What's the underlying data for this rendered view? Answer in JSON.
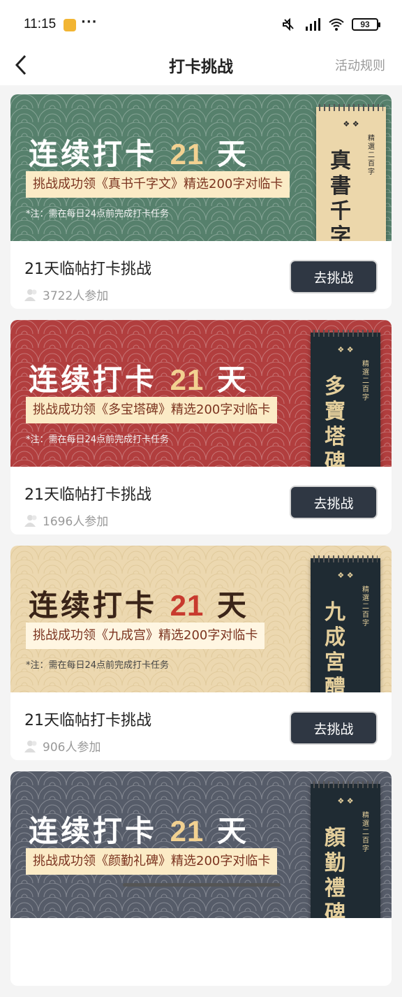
{
  "status": {
    "time": "11:15",
    "battery": "93"
  },
  "header": {
    "title": "打卡挑战",
    "rules_label": "活动规则"
  },
  "challenges": [
    {
      "banner_title": "连续打卡",
      "banner_days": "21",
      "banner_unit": "天",
      "tagline": "挑战成功领《真书千字文》精选200字对临卡",
      "note": "*注：需在每日24点前完成打卡任务",
      "book_title": "真書千字文",
      "book_side": "精選二百字",
      "title": "21天临帖打卡挑战",
      "participants": "3722人参加",
      "button_label": "去挑战",
      "colors": {
        "bg": "#56806c",
        "days": "#f2d191",
        "book_bg": "#ecd7ab",
        "book_text": "#2a2a2a"
      }
    },
    {
      "banner_title": "连续打卡",
      "banner_days": "21",
      "banner_unit": "天",
      "tagline": "挑战成功领《多宝塔碑》精选200字对临卡",
      "note": "*注：需在每日24点前完成打卡任务",
      "book_title": "多寶塔碑",
      "book_side": "精選二百字",
      "title": "21天临帖打卡挑战",
      "participants": "1696人参加",
      "button_label": "去挑战",
      "colors": {
        "bg": "#b13e3e",
        "days": "#f2d191",
        "book_bg": "#1f2b33",
        "book_text": "#e4cf9c"
      }
    },
    {
      "banner_title": "连续打卡",
      "banner_days": "21",
      "banner_unit": "天",
      "tagline": "挑战成功领《九成宫》精选200字对临卡",
      "note": "*注：需在每日24点前完成打卡任务",
      "book_title": "九成宮醴泉銘",
      "book_side": "精選二百字",
      "title": "21天临帖打卡挑战",
      "participants": "906人参加",
      "button_label": "去挑战",
      "colors": {
        "bg": "#ecd8b0",
        "days": "#c83a2e",
        "book_bg": "#1f2b33",
        "book_text": "#e4cf9c"
      }
    },
    {
      "banner_title": "连续打卡",
      "banner_days": "21",
      "banner_unit": "天",
      "tagline": "挑战成功领《颜勤礼碑》精选200字对临卡",
      "note": "",
      "book_title": "顏勤禮碑",
      "book_side": "精選二百字",
      "title": "",
      "participants": "",
      "button_label": "",
      "colors": {
        "bg": "#565c69",
        "days": "#f2d191",
        "book_bg": "#1f2b33",
        "book_text": "#e4cf9c"
      }
    }
  ]
}
